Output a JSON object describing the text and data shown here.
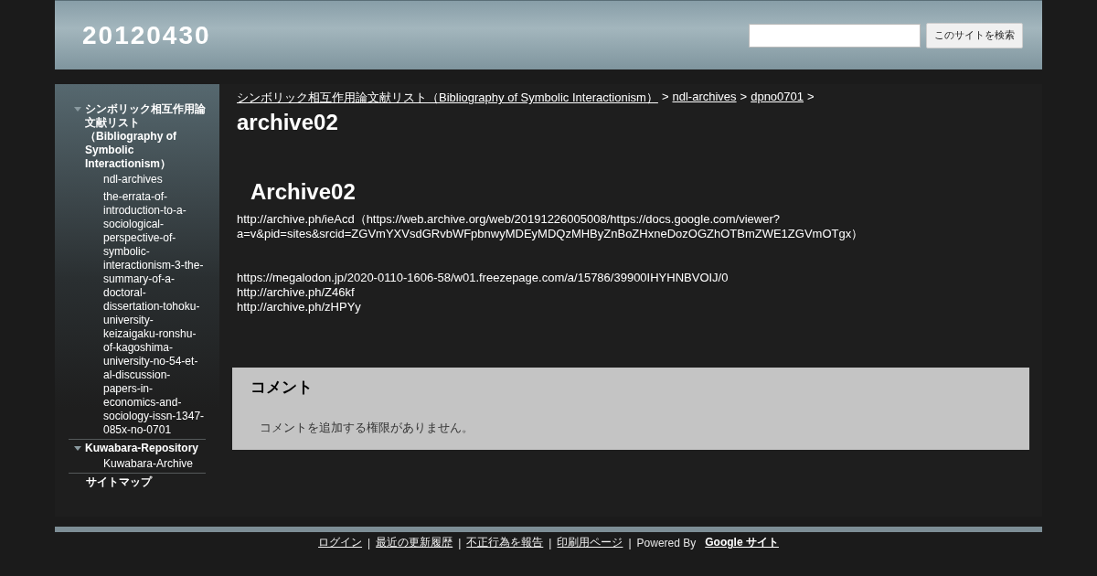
{
  "site_title": "20120430",
  "search": {
    "button": "このサイトを検索"
  },
  "sidebar": {
    "items": [
      {
        "kind": "folder",
        "label": "シンボリック相互作用論文献リスト（Bibliography of Symbolic Interactionism）",
        "expanded": true,
        "children": [
          {
            "label": "ndl-archives"
          },
          {
            "label": "the-errata-of-introduction-to-a-sociological-perspective-of-symbolic-interactionism-3-the-summary-of-a-doctoral-dissertation-tohoku-university-keizaigaku-ronshu-of-kagoshima-university-no-54-et-al-discussion-papers-in-economics-and-sociology-issn-1347-085x-no-0701"
          }
        ]
      },
      {
        "kind": "folder",
        "label": "Kuwabara-Repository",
        "expanded": true,
        "children": [
          {
            "label": "Kuwabara-Archive"
          }
        ]
      },
      {
        "kind": "page",
        "label": "サイトマップ"
      }
    ]
  },
  "breadcrumb": [
    {
      "label": "シンボリック相互作用論文献リスト（Bibliography of Symbolic Interactionism）"
    },
    {
      "label": "ndl-archives"
    },
    {
      "label": "dpno0701"
    }
  ],
  "breadcrumb_separator": ">",
  "page_title": "archive02",
  "heading": "Archive02",
  "paragraphs": [
    [
      "http://archive.ph/ieAcd（https://web.archive.org/web/20191226005008/https://docs.google.com/viewer?a=v&pid=sites&srcid=ZGVmYXVsdGRvbWFpbnwyMDEyMDQzMHByZnBoZHxneDozOGZhOTBmZWE1ZGVmOTgx）"
    ],
    [
      "https://megalodon.jp/2020-0110-1606-58/w01.freezepage.com/a/15786/39900IHYHNBVOIJ/0",
      "http://archive.ph/Z46kf",
      "http://archive.ph/zHPYy"
    ]
  ],
  "comments": {
    "title": "コメント",
    "message": "コメントを追加する権限がありません。"
  },
  "footer": {
    "links": [
      "ログイン",
      "最近の更新履歴",
      "不正行為を報告",
      "印刷用ページ"
    ],
    "separator": "|",
    "powered_by": "Powered By",
    "brand": "Google サイト"
  }
}
